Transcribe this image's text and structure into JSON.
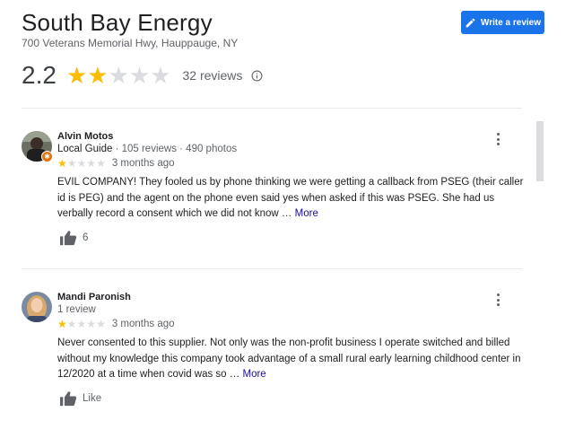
{
  "business": {
    "name": "South Bay Energy",
    "address": "700 Veterans Memorial Hwy, Hauppauge, NY"
  },
  "write_review_label": "Write a review",
  "summary": {
    "rating": "2.2",
    "rating_value": 2.2,
    "reviews_label": "32 reviews"
  },
  "reviews": [
    {
      "name": "Alvin Motos",
      "guide_label": "Local Guide",
      "meta": " · 105 reviews · 490 photos",
      "stars": 1,
      "date": "3 months ago",
      "text": "EVIL COMPANY! They fooled us by phone thinking we were getting a callback from PSEG (their caller id is PEG) and the agent on the phone even said yes when asked if this was PSEG. She had us verbally record a consent which we did not know … ",
      "more": "More",
      "likes": "6"
    },
    {
      "name": "Mandi Paronish",
      "meta": "1 review",
      "stars": 1,
      "date": "3 months ago",
      "text": "Never consented to this supplier.  Not only was the non-profit business I operate switched and billed without my knowledge this company took advantage of a small rural early learning childhood center in 12/2020 at a time when covid was so … ",
      "more": "More",
      "likes": "Like"
    }
  ],
  "colors": {
    "star": "#fbbc04",
    "star_empty": "#dadce0",
    "button": "#1a73e8",
    "link": "#1a0dab",
    "badge": "#e8710a"
  }
}
